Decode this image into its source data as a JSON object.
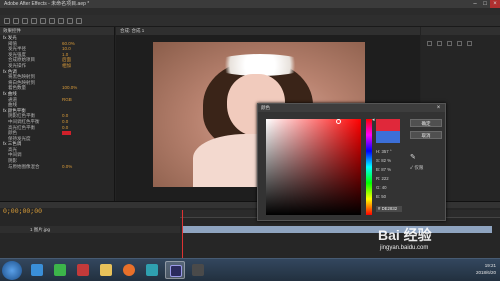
{
  "window": {
    "title": "Adobe After Effects - 未命名项目.aep *"
  },
  "effects_panel": {
    "header": "效果控件",
    "rows": [
      {
        "group": true,
        "name": "fx 发光"
      },
      {
        "name": "阈值",
        "value": "60.0%"
      },
      {
        "name": "发光半径",
        "value": "10.0"
      },
      {
        "name": "发光强度",
        "value": "1.0"
      },
      {
        "name": "合成原始项目",
        "value": "后面"
      },
      {
        "name": "发光操作",
        "value": "相加"
      },
      {
        "group": true,
        "name": "fx 色调"
      },
      {
        "name": "将黑色映射到",
        "value": ""
      },
      {
        "name": "将白色映射到",
        "value": ""
      },
      {
        "name": "着色数量",
        "value": "100.0%"
      },
      {
        "group": true,
        "name": "fx 曲线"
      },
      {
        "name": "通道",
        "value": "RGB"
      },
      {
        "name": "曲线",
        "value": ""
      },
      {
        "group": true,
        "name": "fx 颜色平衡"
      },
      {
        "name": "阴影红色平衡",
        "value": "0.0"
      },
      {
        "name": "中间调红色平衡",
        "value": "0.0"
      },
      {
        "name": "高光红色平衡",
        "value": "0.0"
      },
      {
        "name": "颜色",
        "value": "",
        "swatch": true
      },
      {
        "name": "保持发光度",
        "value": ""
      },
      {
        "group": true,
        "name": "fx 三色调"
      },
      {
        "name": "高光",
        "value": ""
      },
      {
        "name": "中间调",
        "value": ""
      },
      {
        "name": "阴影",
        "value": ""
      },
      {
        "name": "与原始图像混合",
        "value": "0.0%"
      }
    ]
  },
  "composition": {
    "tab": "合成: 合成 1"
  },
  "timeline": {
    "timecode": "0;00;00;00",
    "layer_name": "1  图片.jpg"
  },
  "color_dialog": {
    "title": "颜色",
    "ok_label": "确定",
    "cancel_label": "取消",
    "only_web_colors": "仅限",
    "hsb": [
      "H: 357 °",
      "S: 82 %",
      "B: 87 %",
      "R: 222",
      "G: 40",
      "B: 50"
    ],
    "hex": "# DE2832",
    "colors": {
      "new": "#e0283a",
      "old": "#3c6fd8"
    }
  },
  "taskbar": {
    "time": "19:21",
    "date": "2018/6/20"
  },
  "watermark": {
    "brand": "Bai 经验",
    "url": "jingyan.baidu.com"
  }
}
